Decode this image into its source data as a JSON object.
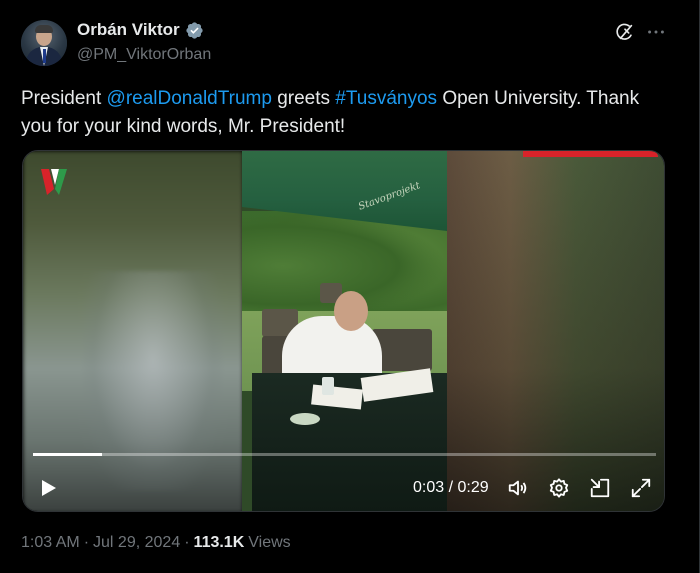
{
  "author": {
    "display_name": "Orbán Viktor",
    "handle": "@PM_ViktorOrban",
    "verified": true,
    "verified_badge_color": "#829aab"
  },
  "tweet": {
    "text_segments": [
      {
        "type": "text",
        "value": "President "
      },
      {
        "type": "mention",
        "value": "@realDonaldTrump"
      },
      {
        "type": "text",
        "value": " greets "
      },
      {
        "type": "hashtag",
        "value": "#Tusványos"
      },
      {
        "type": "text",
        "value": " Open University. Thank you for your kind words, Mr. President!"
      }
    ],
    "link_color": "#1d9bf0"
  },
  "video": {
    "current_time": "0:03",
    "duration": "0:29",
    "time_separator": " / ",
    "progress_fraction": 0.11,
    "umbrella_text": "Stavoprojekt"
  },
  "footer": {
    "time": "1:03 AM",
    "separator": "·",
    "date": "Jul 29, 2024",
    "views_count": "113.1K",
    "views_label": "Views"
  },
  "icons": {
    "header": [
      "grok-icon",
      "more-icon"
    ],
    "controls": [
      "play-icon",
      "volume-icon",
      "settings-icon",
      "pip-icon",
      "fullscreen-icon"
    ]
  }
}
